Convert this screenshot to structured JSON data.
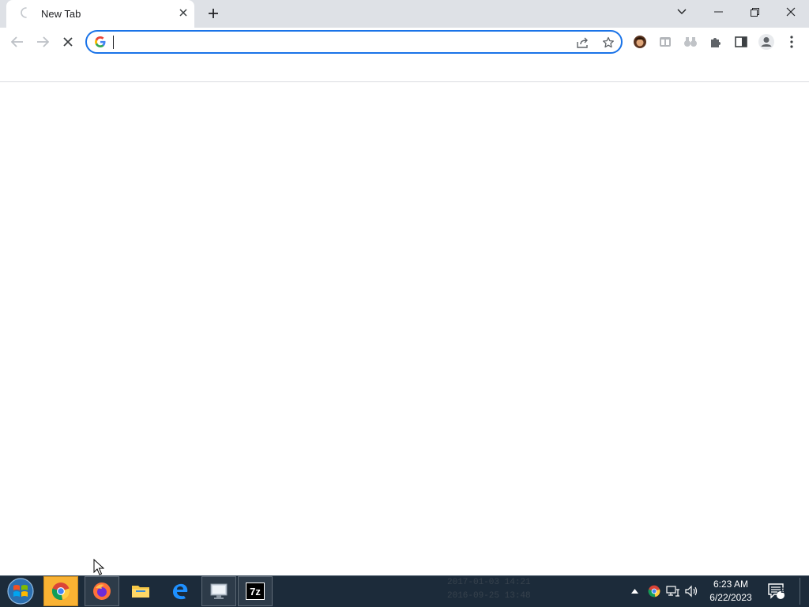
{
  "browser": {
    "tab": {
      "title": "New Tab",
      "loading": true
    },
    "window_controls": [
      "tab-search",
      "minimize",
      "restore",
      "close"
    ],
    "omnibox": {
      "value": "",
      "placeholder": "",
      "search_engine_icon": "google-g-icon"
    },
    "toolbar_icons": [
      "share-icon",
      "bookmark-star-icon",
      "profile-avatar-extension-icon",
      "tab-manager-extension-icon",
      "binoculars-extension-icon",
      "extensions-puzzle-icon",
      "side-panel-icon",
      "account-icon",
      "menu-kebab-icon"
    ],
    "colors": {
      "tabstrip": "#dee1e6",
      "accent": "#1a73e8",
      "page": "#ffffff"
    }
  },
  "taskbar": {
    "apps": [
      "chrome",
      "firefox",
      "file-explorer",
      "edge",
      "remote-desktop",
      "7-zip"
    ],
    "ghost_text": [
      "2017-01-03 14:21",
      "2016-09-25 13:48"
    ],
    "clock": {
      "time": "6:23 AM",
      "date": "6/22/2023"
    },
    "notifications_count": "2",
    "sevenzip_label": "7z"
  }
}
